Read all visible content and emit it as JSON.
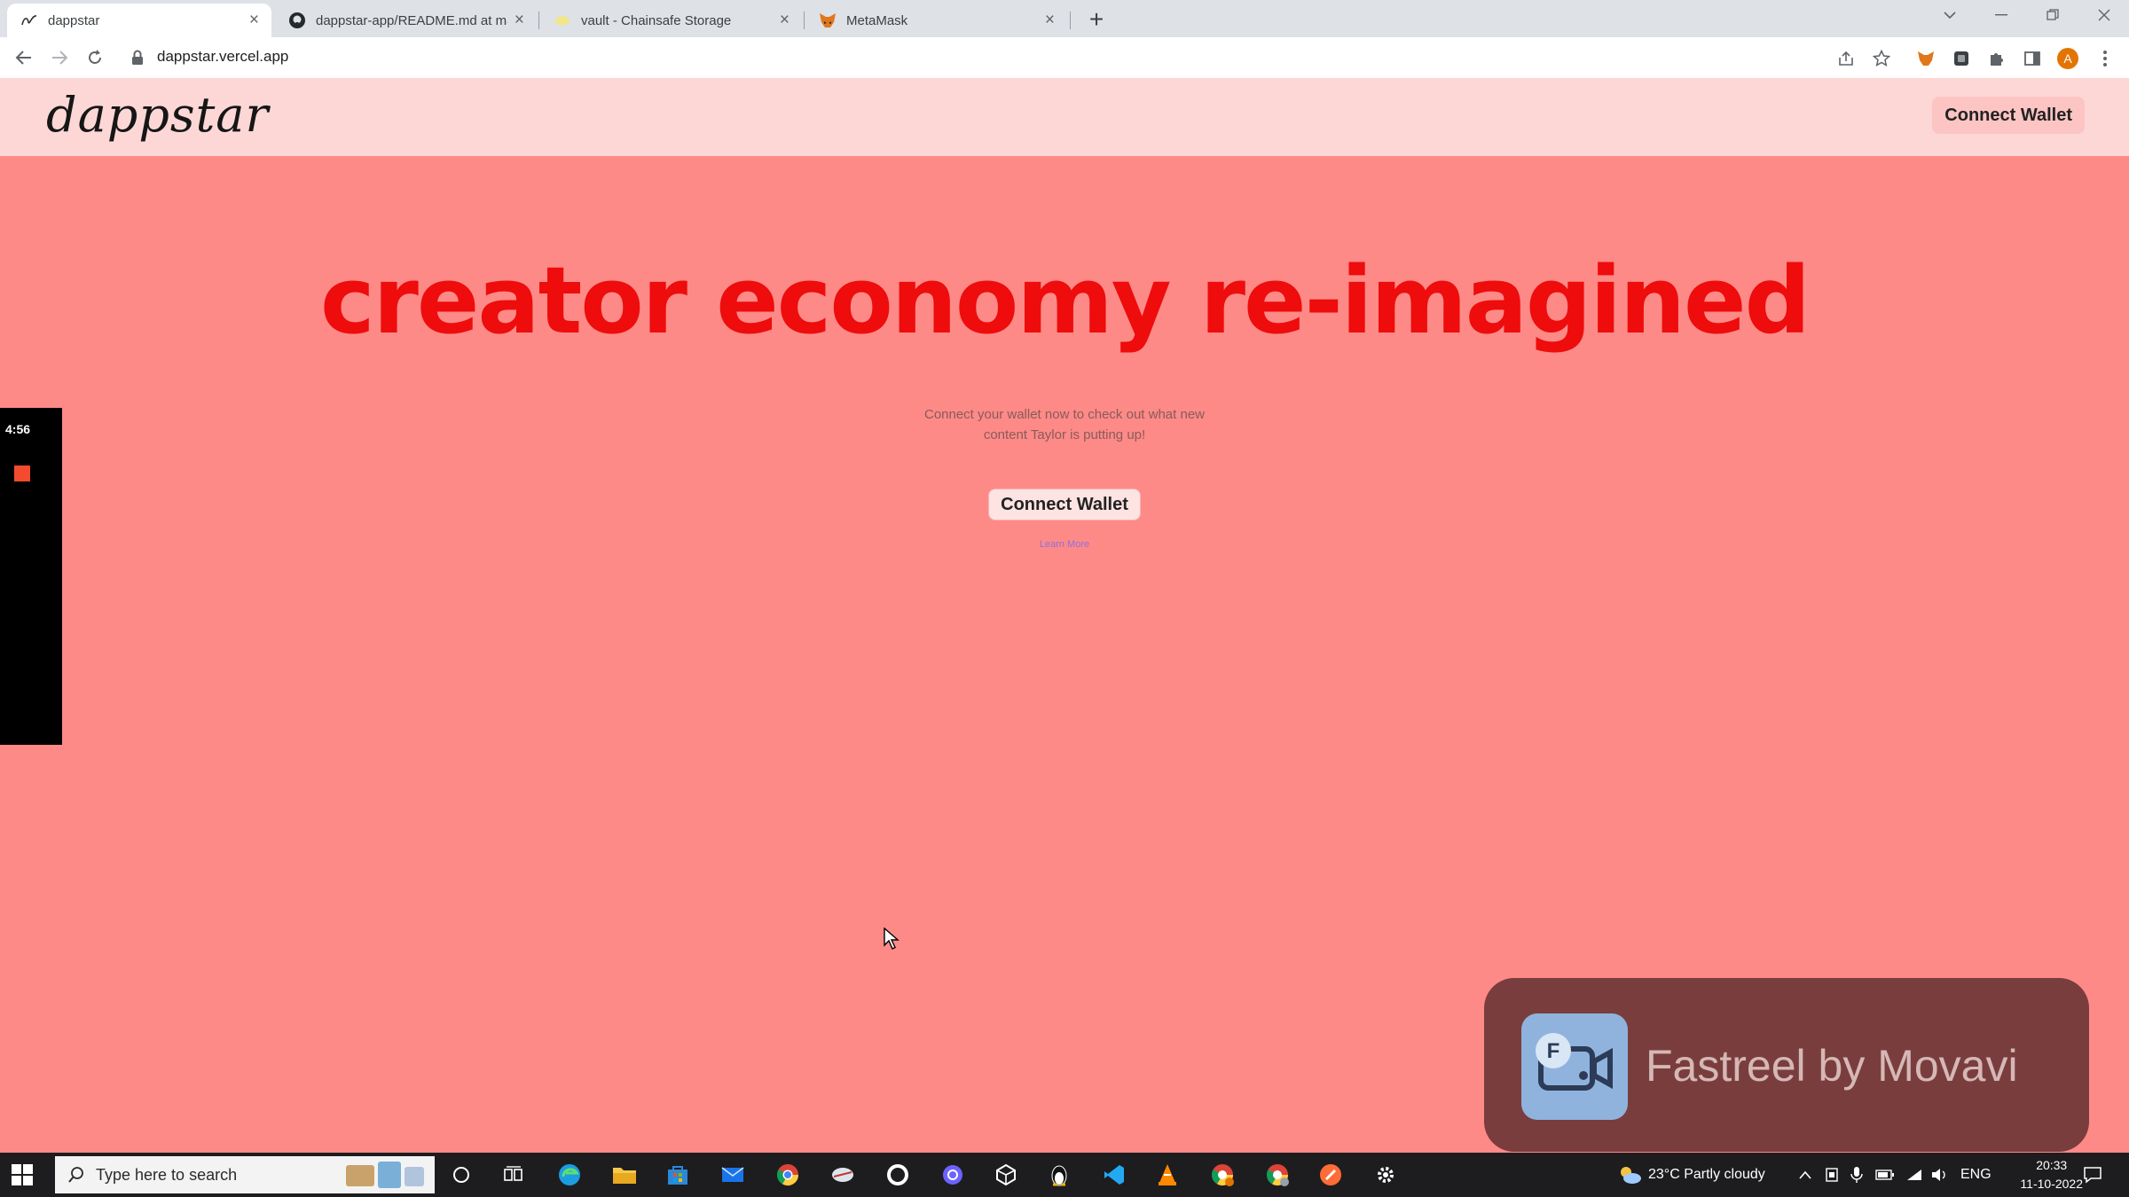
{
  "browser": {
    "tabs": [
      {
        "title": "dappstar",
        "active": true
      },
      {
        "title": "dappstar-app/README.md at ma",
        "active": false
      },
      {
        "title": "vault - Chainsafe Storage",
        "active": false
      },
      {
        "title": "MetaMask",
        "active": false
      }
    ],
    "close_glyph": "×",
    "new_tab_glyph": "+",
    "url": "dappstar.vercel.app"
  },
  "header": {
    "logo": "dappstar",
    "connect_label": "Connect Wallet"
  },
  "hero": {
    "title": "creator economy re-imagined",
    "subtitle_line1": "Connect your wallet now to check out what new",
    "subtitle_line2": "content Taylor is putting up!",
    "cta_label": "Connect Wallet",
    "learn_more": "Learn More"
  },
  "recorder": {
    "time": "4:56"
  },
  "overlay": {
    "brand": "Fastreel by Movavi",
    "icon_letter": "F"
  },
  "taskbar": {
    "search_placeholder": "Type here to search",
    "weather": "23°C  Partly cloudy",
    "language": "ENG",
    "time": "20:33",
    "date": "11-10-2022"
  },
  "colors": {
    "page_bg": "#fd8a87",
    "header_bg": "#fdd7d6",
    "hero_title": "#ee0c0c",
    "overlay_bg": "#7a3d3d"
  }
}
